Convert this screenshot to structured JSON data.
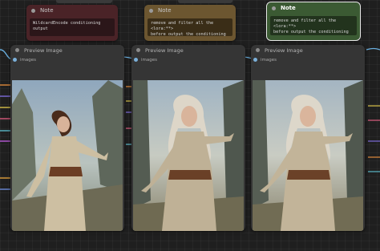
{
  "notes": [
    {
      "title": "Note",
      "text": "WildcardEncode conditioning output",
      "bg": "#4a2327",
      "body_bg": "#2b1619"
    },
    {
      "title": "Note",
      "text": "remove and filter all the <lora:**>\nbefore output the conditioning",
      "bg": "#6c5630",
      "body_bg": "#3a2d17"
    },
    {
      "title": "Note",
      "text": "remove and filter all the <lora:**>\nbefore output the conditioning\n(RestartSampler)",
      "bg": "#3b5a33",
      "body_bg": "#22331d"
    }
  ],
  "panels": [
    {
      "title": "Preview Image",
      "input_label": "images"
    },
    {
      "title": "Preview Image",
      "input_label": "images"
    },
    {
      "title": "Preview Image",
      "input_label": "images"
    }
  ],
  "colors": {
    "canvas": "#1f1f1f",
    "panel": "#353535",
    "input_dot": "#7bb0d9",
    "selected_outline": "#e8e8e8"
  }
}
